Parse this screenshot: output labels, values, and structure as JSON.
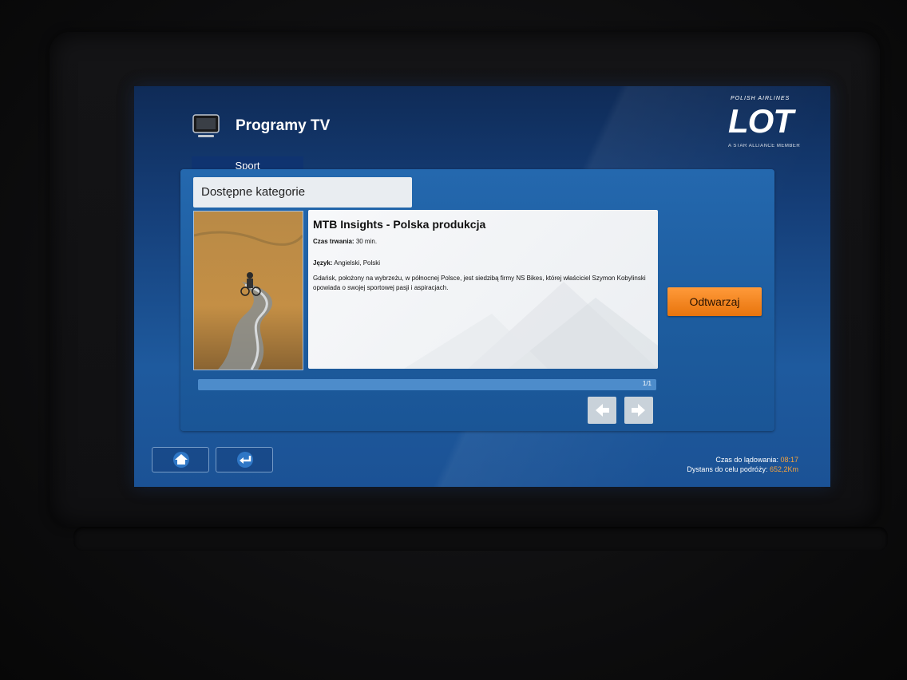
{
  "header": {
    "title": "Programy TV",
    "tab_label": "Sport"
  },
  "brand": {
    "top_text": "POLISH AIRLINES",
    "name": "LOT",
    "tagline": "A STAR ALLIANCE MEMBER"
  },
  "panel": {
    "category_title": "Dostępne kategorie",
    "item": {
      "title": "MTB Insights - Polska produkcja",
      "duration_label": "Czas trwania:",
      "duration_value": "30 min.",
      "language_label": "Język:",
      "language_value": "Angielski, Polski",
      "description": "Gdańsk, położony na wybrzeżu, w północnej Polsce, jest siedzibą firmy NS Bikes, której właściciel Szymon Kobylinski opowiada o swojej sportowej pasji i aspiracjach."
    },
    "play_label": "Odtwarzaj",
    "page_indicator": "1/1",
    "progress_fraction": 1.0
  },
  "footer": {
    "landing_label": "Czas do lądowania:",
    "landing_value": "08:17",
    "distance_label": "Dystans do celu podróży:",
    "distance_value": "652,2Km"
  },
  "icons": {
    "tv": "tv-icon",
    "home": "home-icon",
    "back": "back-icon",
    "prev": "arrow-left-icon",
    "next": "arrow-right-icon"
  },
  "colors": {
    "accent": "#e8740c",
    "status_value": "#f6a33c",
    "screen_blue": "#1e5a9e"
  }
}
